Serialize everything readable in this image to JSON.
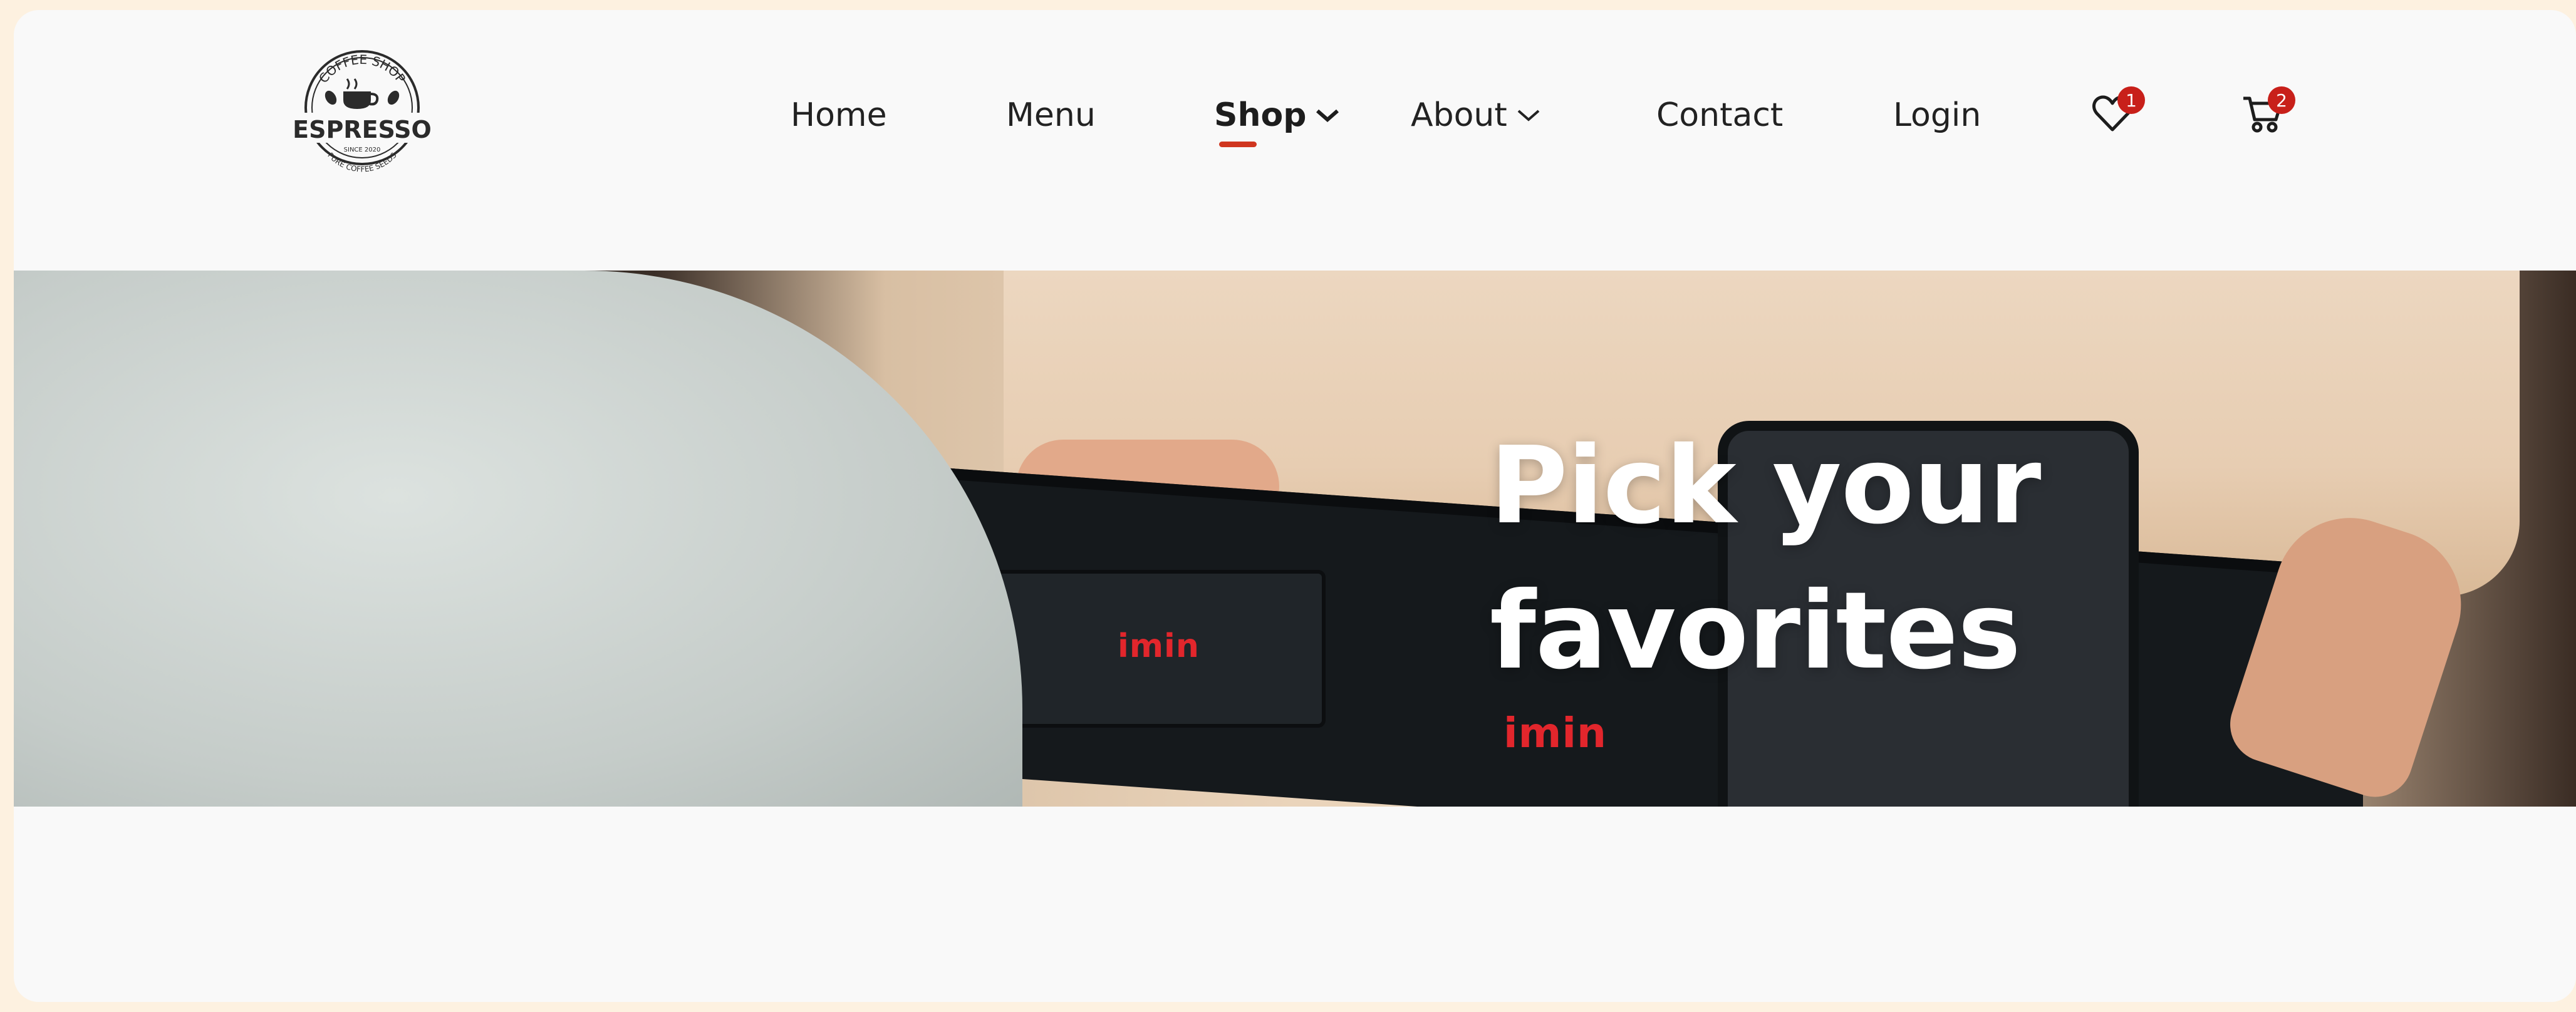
{
  "logo": {
    "top_text": "COFFEE SHOP",
    "name": "ESPRESSO",
    "since": "SINCE 2020",
    "bottom_text": "PURE COFFEE SEEDS"
  },
  "nav": {
    "items": [
      {
        "label": "Home",
        "active": false,
        "has_dropdown": false
      },
      {
        "label": "Menu",
        "active": false,
        "has_dropdown": false
      },
      {
        "label": "Shop",
        "active": true,
        "has_dropdown": true
      },
      {
        "label": "About",
        "active": false,
        "has_dropdown": true
      },
      {
        "label": "Contact",
        "active": false,
        "has_dropdown": false
      },
      {
        "label": "Login",
        "active": false,
        "has_dropdown": false
      }
    ]
  },
  "wishlist": {
    "icon": "heart-icon",
    "count": "1"
  },
  "cart": {
    "icon": "cart-icon",
    "count": "2"
  },
  "hero": {
    "title_line1": "Pick your",
    "title_line2": "favorites",
    "photo_brand_text": "imin"
  },
  "colors": {
    "accent": "#d0361f",
    "badge": "#c8201a",
    "page_background": "#f9f9f9",
    "outer_background": "#fdf1e0"
  }
}
